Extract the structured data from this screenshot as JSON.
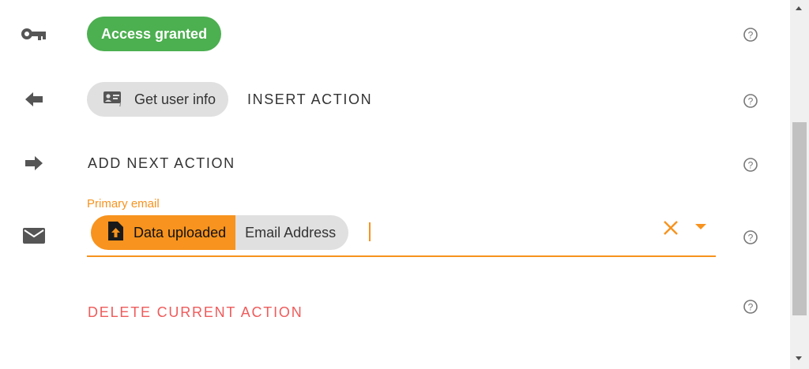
{
  "rows": {
    "access": {
      "icon": "key-icon",
      "chip_label": "Access granted",
      "chip_color": "#4caf50",
      "help_icon": "help-circle-icon"
    },
    "get_user": {
      "icon": "arrow-left-icon",
      "chip_icon": "contact-card-icon",
      "chip_label": "Get user info",
      "action_label": "INSERT ACTION",
      "help_icon": "help-circle-icon"
    },
    "next": {
      "icon": "arrow-right-icon",
      "action_label": "ADD NEXT ACTION",
      "help_icon": "help-circle-icon"
    },
    "email": {
      "icon": "mail-icon",
      "field_label": "Primary email",
      "accent_color": "#f7931e",
      "pill_source_icon": "file-upload-icon",
      "pill_source": "Data uploaded",
      "pill_value": "Email Address",
      "clear_icon": "close-icon",
      "dropdown_icon": "caret-down-icon",
      "help_icon": "help-circle-icon"
    },
    "delete": {
      "label": "DELETE CURRENT ACTION",
      "color": "#ef5b5b",
      "help_icon": "help-circle-icon"
    }
  }
}
